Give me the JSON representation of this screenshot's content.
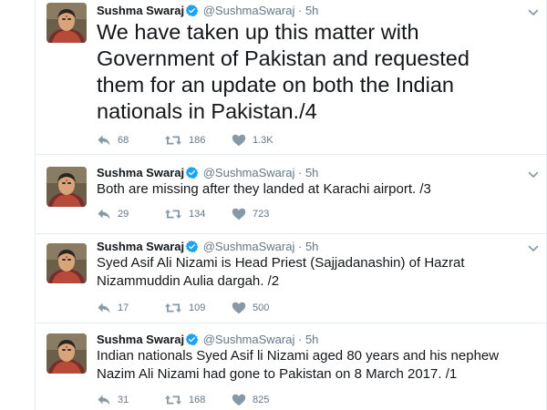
{
  "tweets": [
    {
      "name": "Sushma Swaraj",
      "handle": "@SushmaSwaraj",
      "dot": "·",
      "time": "5h",
      "text": "We have taken up this matter with Government of Pakistan and requested them for an update on both the Indian nationals in Pakistan./4",
      "replies": "68",
      "retweets": "186",
      "likes": "1.3K"
    },
    {
      "name": "Sushma Swaraj",
      "handle": "@SushmaSwaraj",
      "dot": "·",
      "time": "5h",
      "text": "Both are missing after they landed at Karachi airport. /3",
      "replies": "29",
      "retweets": "134",
      "likes": "723"
    },
    {
      "name": "Sushma Swaraj",
      "handle": "@SushmaSwaraj",
      "dot": "·",
      "time": "5h",
      "text": "Syed Asif Ali Nizami is Head Priest (Sajjadanashin) of Hazrat Nizammuddin Aulia dargah.  /2",
      "replies": "17",
      "retweets": "109",
      "likes": "500"
    },
    {
      "name": "Sushma Swaraj",
      "handle": "@SushmaSwaraj",
      "dot": "·",
      "time": "5h",
      "text": "Indian nationals Syed Asif li Nizami aged 80 years and his nephew Nazim Ali Nizami had gone to Pakistan on 8 March 2017. /1",
      "replies": "31",
      "retweets": "168",
      "likes": "825"
    }
  ],
  "icons": {
    "reply": "reply-icon",
    "retweet": "retweet-icon",
    "like": "heart-icon",
    "verified": "verified-badge-icon",
    "more": "chevron-down-icon"
  },
  "colors": {
    "verified": "#1da1f2",
    "muted": "#657786",
    "text": "#14171a",
    "divider": "#e6ecf0"
  }
}
